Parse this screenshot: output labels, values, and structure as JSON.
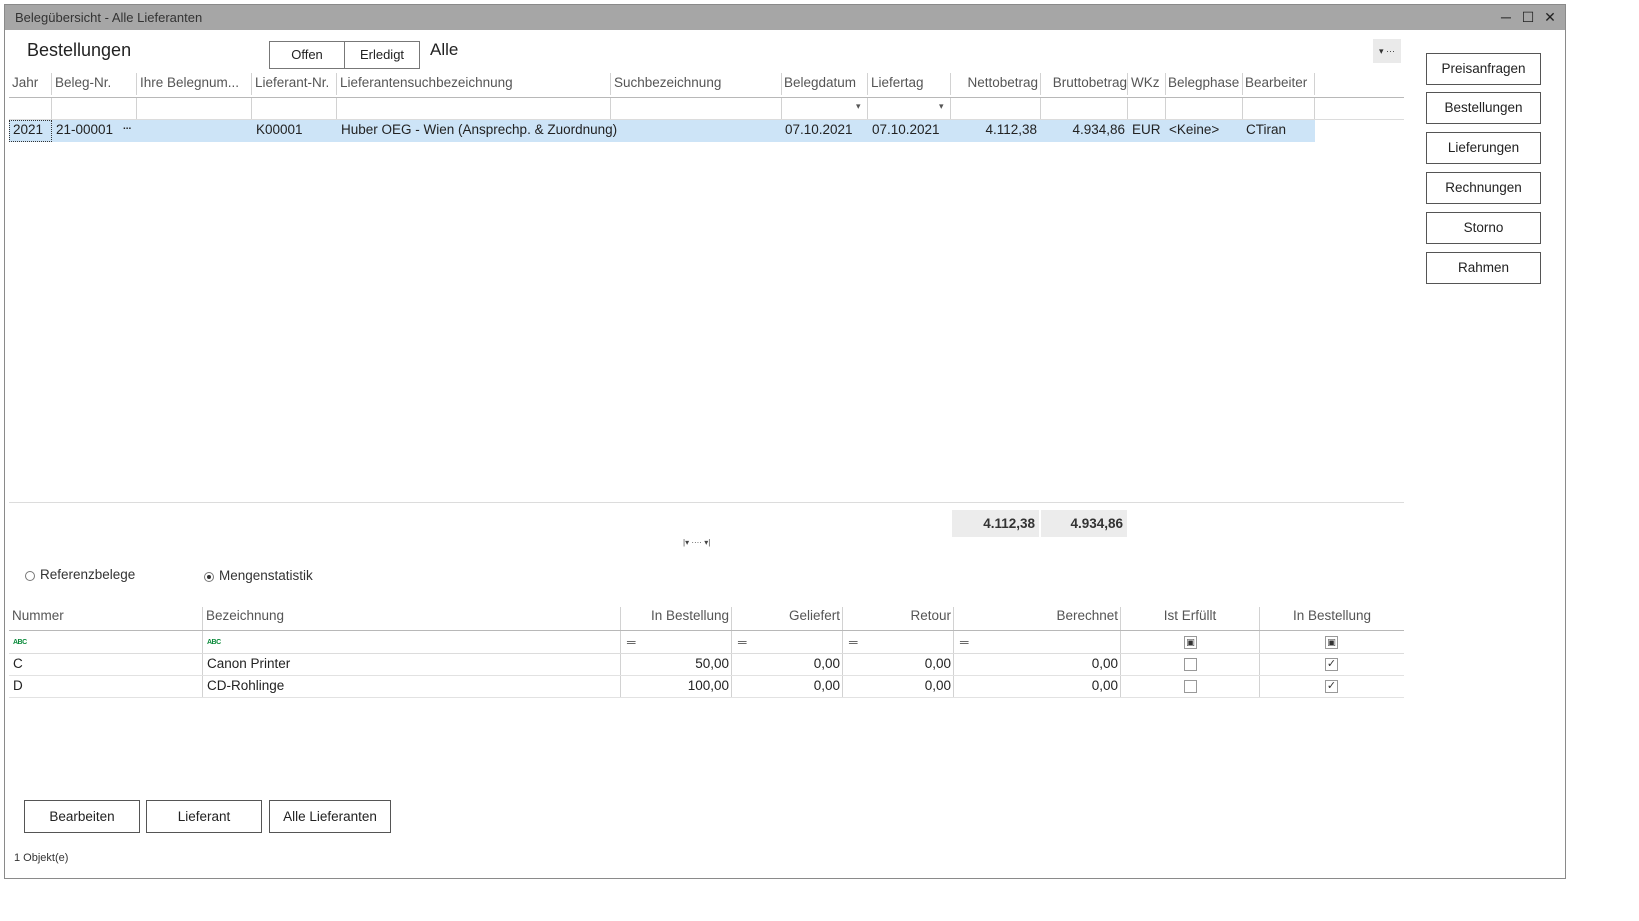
{
  "window": {
    "title": "Belegübersicht - Alle Lieferanten",
    "minimize": "─",
    "maximize": "☐",
    "close": "✕"
  },
  "main": {
    "section_title": "Bestellungen",
    "filter_buttons": [
      "Offen",
      "Erledigt"
    ],
    "filter_active": "Alle",
    "menu_glyph": "▾ ···"
  },
  "grid": {
    "columns": [
      "Jahr",
      "Beleg-Nr.",
      "Ihre Belegnum...",
      "Lieferant-Nr.",
      "Lieferantensuchbezeichnung",
      "Suchbezeichnung",
      "Belegdatum",
      "Liefertag",
      "Nettobetrag",
      "Bruttobetrag",
      "WKz",
      "Belegphase",
      "Bearbeiter"
    ],
    "rows": [
      {
        "jahr": "2021",
        "beleg_nr": "21-00001",
        "ellipsis": "...",
        "lieferant_nr": "K00001",
        "lieferant_such": "Huber OEG - Wien (Ansprechp. & Zuordnung)",
        "belegdatum": "07.10.2021",
        "liefertag": "07.10.2021",
        "netto": "4.112,38",
        "brutto": "4.934,86",
        "wkz": "EUR",
        "belegphase": "<Keine>",
        "bearbeiter": "CTiran"
      }
    ],
    "totals": {
      "netto": "4.112,38",
      "brutto": "4.934,86"
    },
    "splitter_glyph": "|▾ ···· ▾|"
  },
  "lower": {
    "radio_options": [
      "Referenzbelege",
      "Mengenstatistik"
    ],
    "radio_selected": "Mengenstatistik",
    "columns": [
      "Nummer",
      "Bezeichnung",
      "In Bestellung",
      "Geliefert",
      "Retour",
      "Berechnet",
      "Ist Erfüllt",
      "In Bestellung"
    ],
    "filter_abc": "ABC",
    "filter_eq": "═",
    "rows": [
      {
        "nummer": "C",
        "bezeichnung": "Canon Printer",
        "in_bestellung": "50,00",
        "geliefert": "0,00",
        "retour": "0,00",
        "berechnet": "0,00",
        "ist_erfuellt": false,
        "in_bestellung_flag": true
      },
      {
        "nummer": "D",
        "bezeichnung": "CD-Rohlinge",
        "in_bestellung": "100,00",
        "geliefert": "0,00",
        "retour": "0,00",
        "berechnet": "0,00",
        "ist_erfuellt": false,
        "in_bestellung_flag": true
      }
    ]
  },
  "sidebar": {
    "buttons": [
      "Preisanfragen",
      "Bestellungen",
      "Lieferungen",
      "Rechnungen",
      "Storno",
      "Rahmen"
    ]
  },
  "footer": {
    "buttons": [
      "Bearbeiten",
      "Lieferant",
      "Alle Lieferanten"
    ],
    "status": "1 Objekt(e)"
  },
  "glyphs": {
    "check": "✓",
    "dropdown": "▾",
    "filter_square": "▣"
  }
}
